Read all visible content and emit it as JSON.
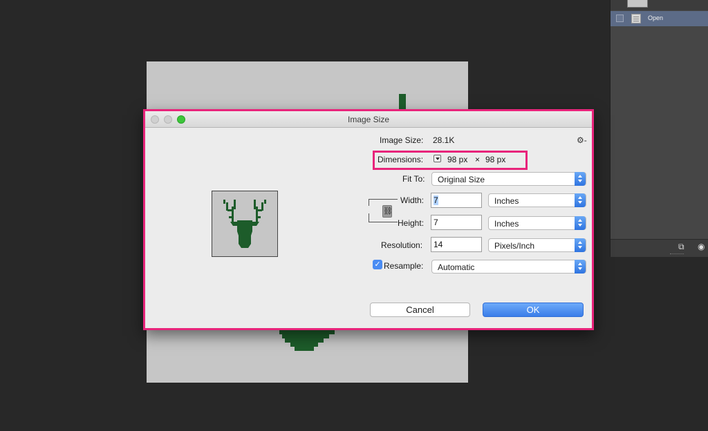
{
  "dialog": {
    "title": "Image Size",
    "image_size_label": "Image Size:",
    "image_size_value": "28.1K",
    "gear_glyph": "⚙-",
    "dimensions_label": "Dimensions:",
    "dimensions_w": "98 px",
    "dimensions_x": "×",
    "dimensions_h": "98 px",
    "fit_to_label": "Fit To:",
    "fit_to_value": "Original Size",
    "width_label": "Width:",
    "width_value": "7",
    "width_unit": "Inches",
    "height_label": "Height:",
    "height_value": "7",
    "height_unit": "Inches",
    "resolution_label": "Resolution:",
    "resolution_value": "14",
    "resolution_unit": "Pixels/Inch",
    "resample_label": "Resample:",
    "resample_checked": true,
    "resample_value": "Automatic",
    "cancel_label": "Cancel",
    "ok_label": "OK",
    "highlight_color": "#e8247b",
    "deer_color": "#1d5c2a"
  },
  "history": {
    "item_label": "Open"
  },
  "icons": {
    "gear": "gear-icon",
    "link": "chain-link-icon",
    "check": "checkmark-icon",
    "new_doc": "new-document-icon",
    "camera": "camera-icon"
  }
}
